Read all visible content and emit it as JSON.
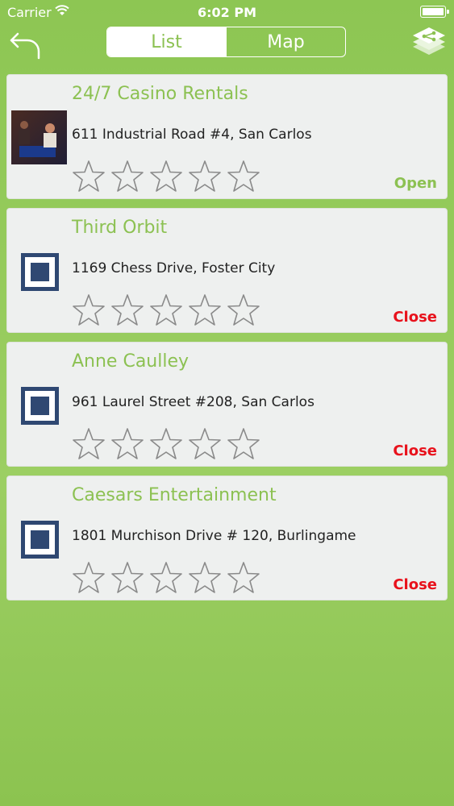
{
  "status_bar": {
    "carrier": "Carrier",
    "time": "6:02 PM"
  },
  "nav": {
    "back_icon": "back-arrow-icon",
    "segments": [
      {
        "label": "List",
        "selected": true
      },
      {
        "label": "Map",
        "selected": false
      }
    ],
    "share_icon": "share-stack-icon"
  },
  "colors": {
    "accent": "#8cc152",
    "open": "#8cc152",
    "closed": "#e8121c",
    "card_bg": "#eef0ef"
  },
  "listings": [
    {
      "name": "24/7 Casino Rentals",
      "address": "611 Industrial Road #4, San Carlos",
      "rating": 0,
      "max_rating": 5,
      "status": "Open",
      "thumb": "photo"
    },
    {
      "name": "Third Orbit",
      "address": "1169 Chess Drive, Foster City",
      "rating": 0,
      "max_rating": 5,
      "status": "Close",
      "thumb": "placeholder-square-icon"
    },
    {
      "name": "Anne Caulley",
      "address": "961 Laurel Street #208, San Carlos",
      "rating": 0,
      "max_rating": 5,
      "status": "Close",
      "thumb": "placeholder-square-icon"
    },
    {
      "name": "Caesars Entertainment",
      "address": "1801 Murchison Drive # 120, Burlingame",
      "rating": 0,
      "max_rating": 5,
      "status": "Close",
      "thumb": "placeholder-square-icon"
    }
  ]
}
